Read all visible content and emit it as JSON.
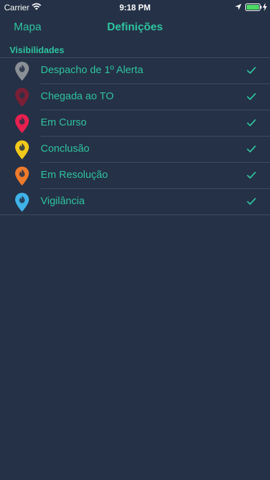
{
  "status_bar": {
    "carrier": "Carrier",
    "time": "9:18 PM"
  },
  "nav": {
    "back_label": "Mapa",
    "title": "Definições"
  },
  "section": {
    "title": "Visibilidades"
  },
  "items": [
    {
      "label": "Despacho de 1º Alerta",
      "pin_color": "#8b8f96",
      "checked": true
    },
    {
      "label": "Chegada ao TO",
      "pin_color": "#7a1f35",
      "checked": true
    },
    {
      "label": "Em Curso",
      "pin_color": "#e8204f",
      "checked": true
    },
    {
      "label": "Conclusão",
      "pin_color": "#f2c81b",
      "checked": true
    },
    {
      "label": "Em Resolução",
      "pin_color": "#ee7a2b",
      "checked": true
    },
    {
      "label": "Vigilância",
      "pin_color": "#3fb2e8",
      "checked": true
    }
  ],
  "colors": {
    "background": "#253146",
    "accent": "#2ec4a0",
    "separator": "#3f4c60",
    "battery": "#4cd964"
  }
}
